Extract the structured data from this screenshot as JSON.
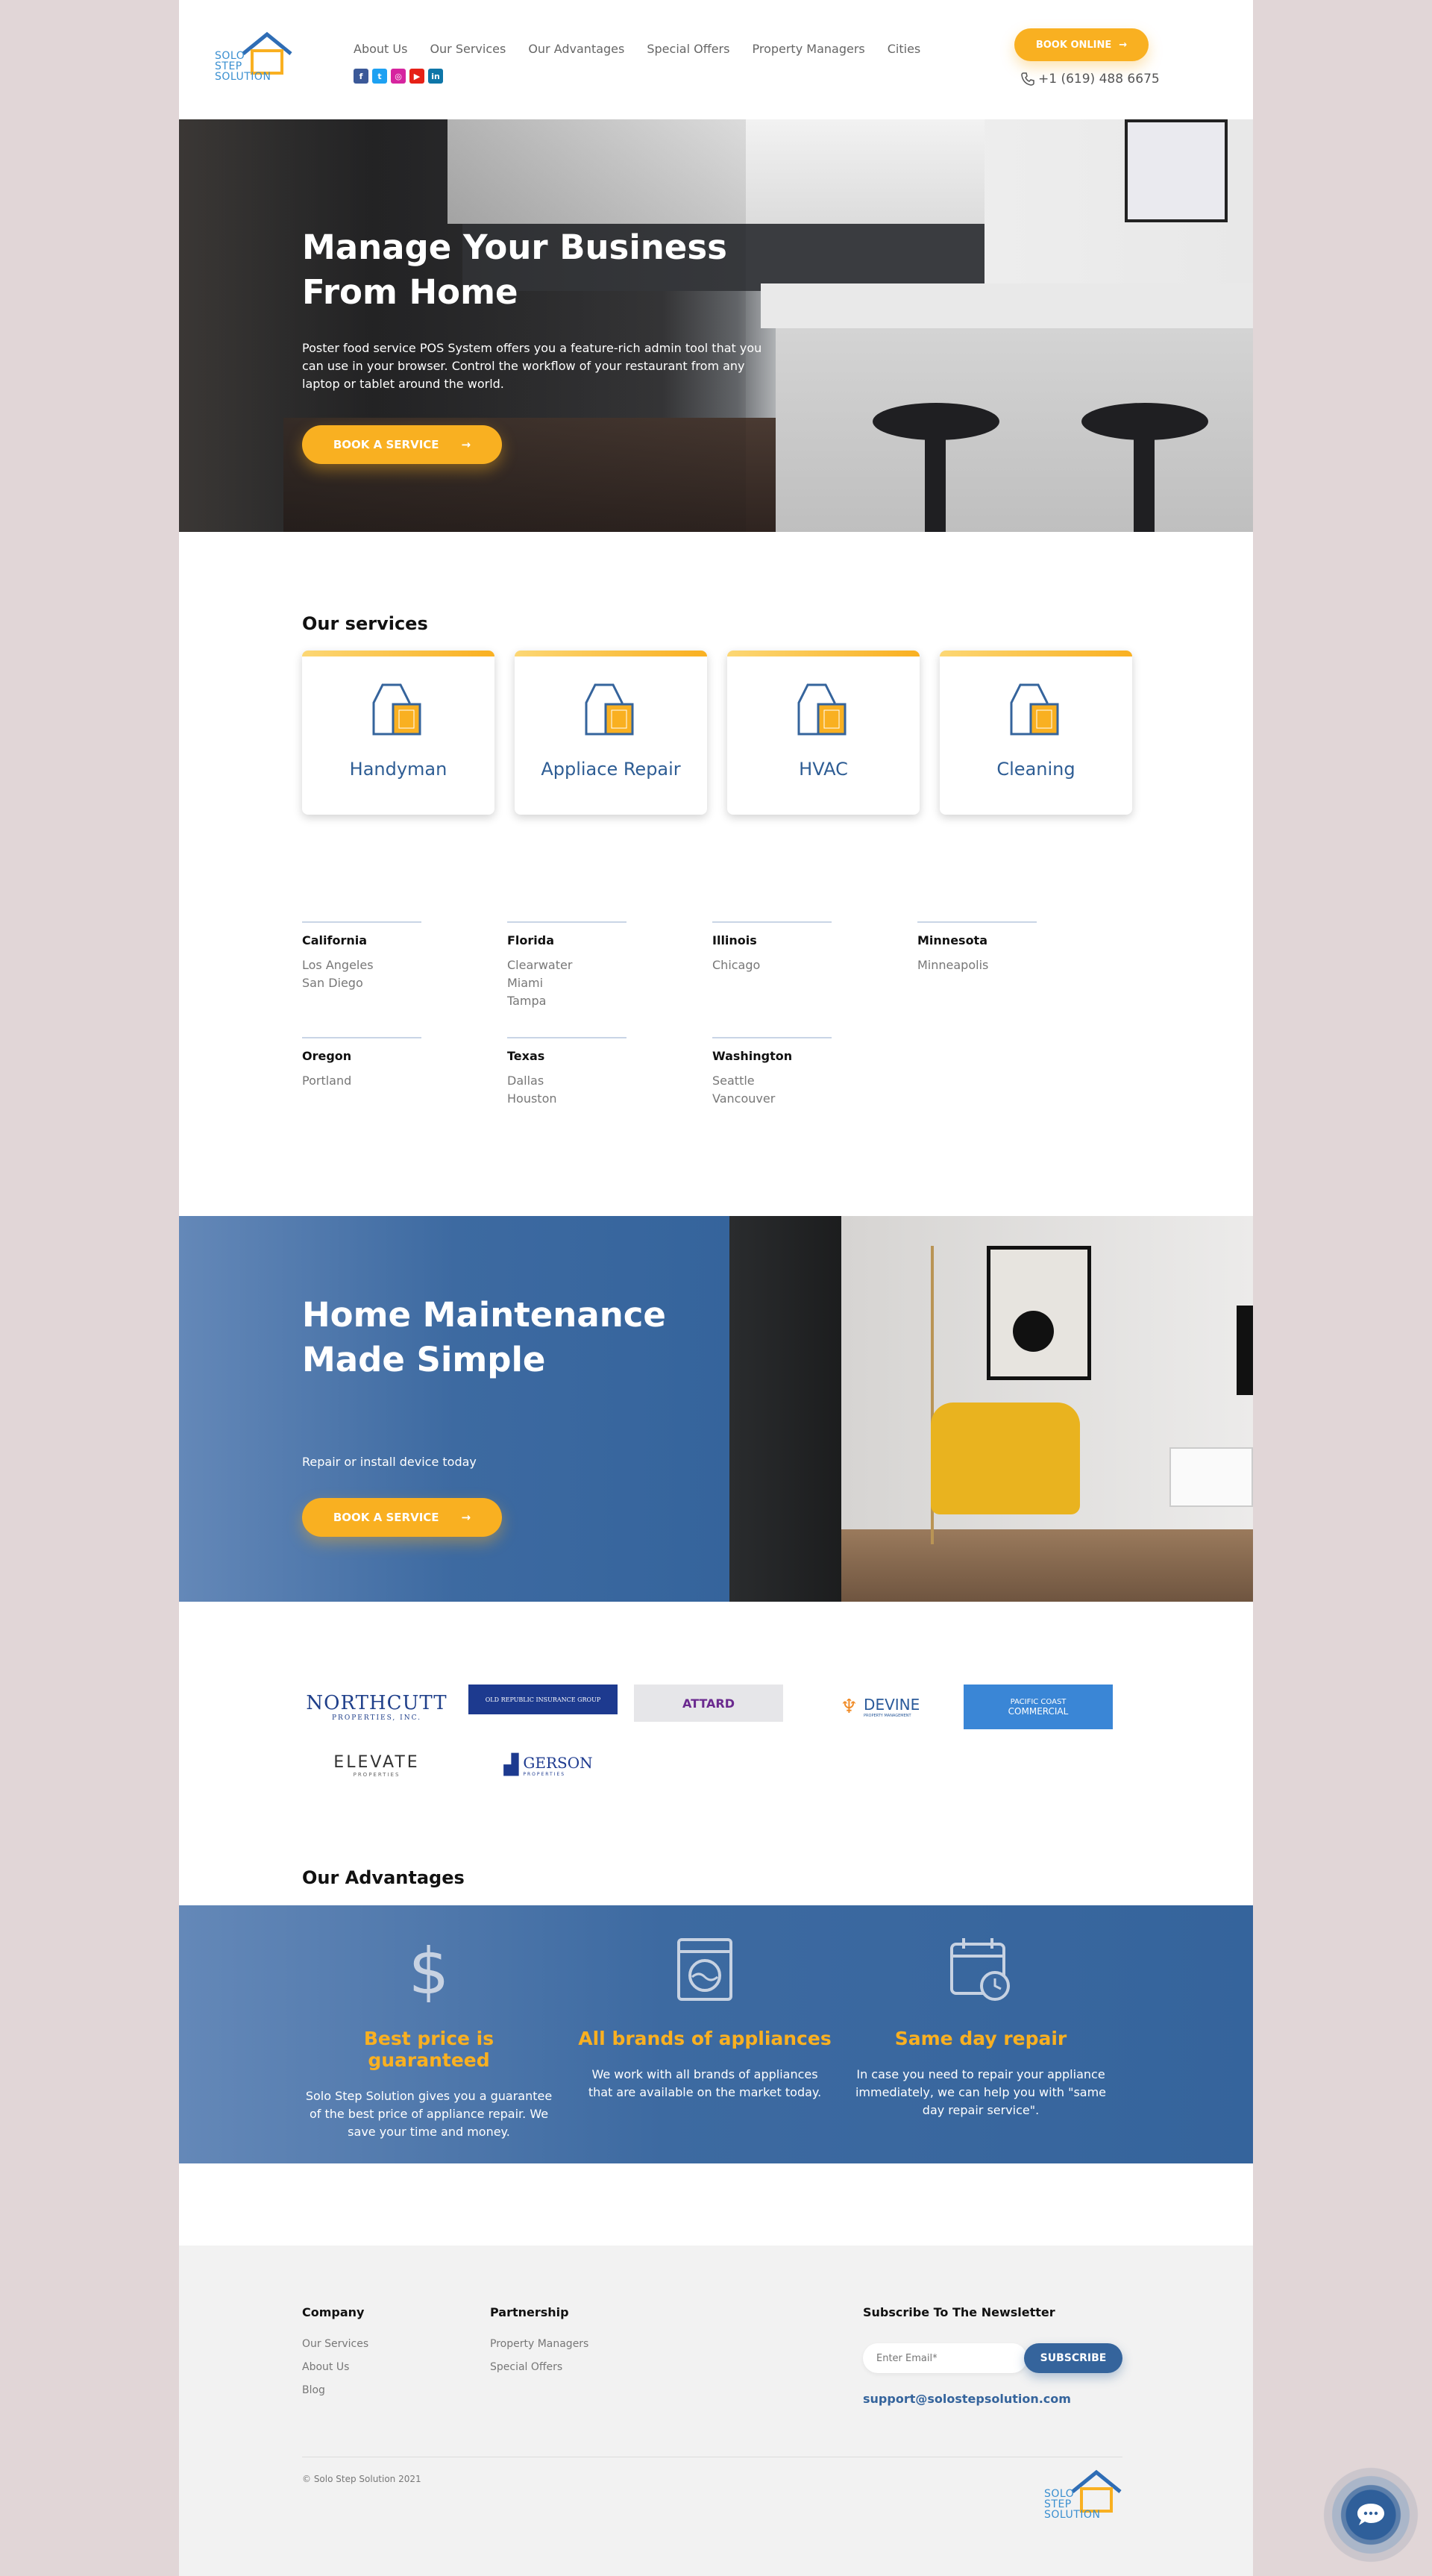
{
  "header": {
    "logo": [
      "SOLO",
      "STEP",
      "SOLUTION"
    ],
    "nav": [
      "About Us",
      "Our Services",
      "Our Advantages",
      "Special Offers",
      "Property Managers",
      "Cities"
    ],
    "socials": [
      "facebook-icon",
      "twitter-icon",
      "instagram-icon",
      "youtube-icon",
      "linkedin-icon"
    ],
    "book_online": "BOOK ONLINE",
    "phone": "+1 (619) 488 6675"
  },
  "hero": {
    "title": "Manage Your Business From Home",
    "text": "Poster food service POS System offers you a feature-rich admin tool that you can use in your browser. Control the workflow of your restaurant from any laptop or tablet around the world.",
    "button": "BOOK A SERVICE"
  },
  "services": {
    "title": "Our services",
    "items": [
      "Handyman",
      "Appliace Repair",
      "HVAC",
      "Cleaning"
    ]
  },
  "cities": [
    {
      "state": "California",
      "cities": [
        "Los Angeles",
        "San Diego"
      ]
    },
    {
      "state": "Florida",
      "cities": [
        "Clearwater",
        "Miami",
        "Tampa"
      ]
    },
    {
      "state": "Illinois",
      "cities": [
        "Chicago"
      ]
    },
    {
      "state": "Minnesota",
      "cities": [
        "Minneapolis"
      ]
    },
    {
      "state": "Oregon",
      "cities": [
        "Portland"
      ]
    },
    {
      "state": "Texas",
      "cities": [
        "Dallas",
        "Houston"
      ]
    },
    {
      "state": "Washington",
      "cities": [
        "Seattle",
        "Vancouver"
      ]
    }
  ],
  "banner": {
    "title": "Home Maintenance Made Simple",
    "subtitle": "Repair or install device today",
    "button": "BOOK A SERVICE"
  },
  "partners": [
    "NORTHCUTT",
    "PROPERTIES, INC.",
    "OLD REPUBLIC INSURANCE GROUP",
    "ATTARD",
    "DEVINE",
    "PROPERTY MANAGEMENT",
    "PACIFIC COAST",
    "COMMERCIAL",
    "ELEVATE",
    "PROPERTIES",
    "GERSON",
    "PROPERTIES"
  ],
  "advantages": {
    "title": "Our Advantages",
    "items": [
      {
        "icon": "dollar-icon",
        "title": "Best price is guaranteed",
        "text": "Solo Step Solution gives you a guarantee of the best price of appliance repair. We save your time and money."
      },
      {
        "icon": "washing-machine-icon",
        "title": "All brands of appliances",
        "text": "We work with all brands of appliances that are available on the market today."
      },
      {
        "icon": "calendar-clock-icon",
        "title": "Same day repair",
        "text": "In case you need to repair your appliance immediately, we can help you with \"same day repair service\"."
      }
    ]
  },
  "footer": {
    "company_title": "Company",
    "company_links": [
      "Our Services",
      "About Us",
      "Blog"
    ],
    "partnership_title": "Partnership",
    "partnership_links": [
      "Property Managers",
      "Special Offers"
    ],
    "newsletter_title": "Subscribe To The Newsletter",
    "email_placeholder": "Enter Email*",
    "subscribe": "SUBSCRIBE",
    "email": "support@solostepsolution.com",
    "copyright": "© Solo Step Solution 2021"
  },
  "colors": {
    "accent": "#f9b021",
    "brand_blue": "#35649c",
    "logo_blue": "#3a8fd0"
  }
}
